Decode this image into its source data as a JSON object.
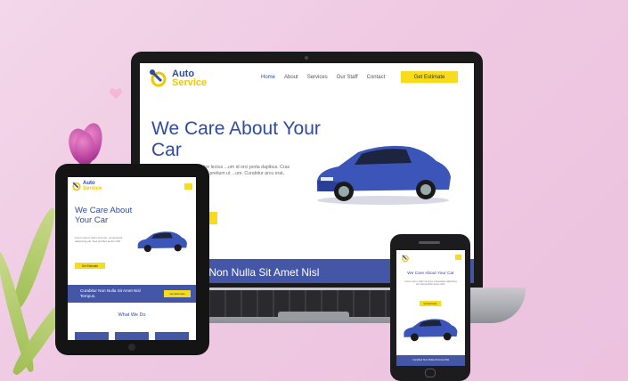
{
  "colors": {
    "brand_blue": "#2f4aa3",
    "brand_yellow": "#f7dc1d",
    "band_blue": "#4457a6",
    "background": "#efc9e2"
  },
  "site": {
    "logo_line1": "Auto",
    "logo_line2": "Service",
    "nav": [
      "Home",
      "About",
      "Services",
      "Our Staff",
      "Contact"
    ],
    "estimate_button": "Get Estimate",
    "hero_title": "We Care About Your Car",
    "hero_body": "...e malesuada. Sed porttitor lectus ...um id orci porta dapibus. Cras ultricies ...Quisque velit nisi, pretium ut ...um. Curabitur arcu erat, accumsan",
    "band_text": "...r Non Nulla Sit Amet Nisl"
  },
  "tablet": {
    "logo_line1": "Auto",
    "logo_line2": "Service",
    "hero_title": "We Care About Your Car",
    "hero_body": "Lorem ipsum dolor sit amet, consectetur adipiscing elit. Sed porttitor lectus nibh.",
    "button": "Get Estimate",
    "band_text": "Curabitur Non Nulla Sit Amet Nisl Tempus.",
    "band_button": "Get Estimate",
    "section_title": "What We Do"
  },
  "phone": {
    "hero_title": "We Care About Your Car",
    "hero_body": "Lorem ipsum dolor sit amet, consectetur adipiscing elit. Sed porttitor lectus nibh.",
    "button": "Get Estimate",
    "band_text": "Curabitur Non Nulla Sit Amet Nisl"
  }
}
